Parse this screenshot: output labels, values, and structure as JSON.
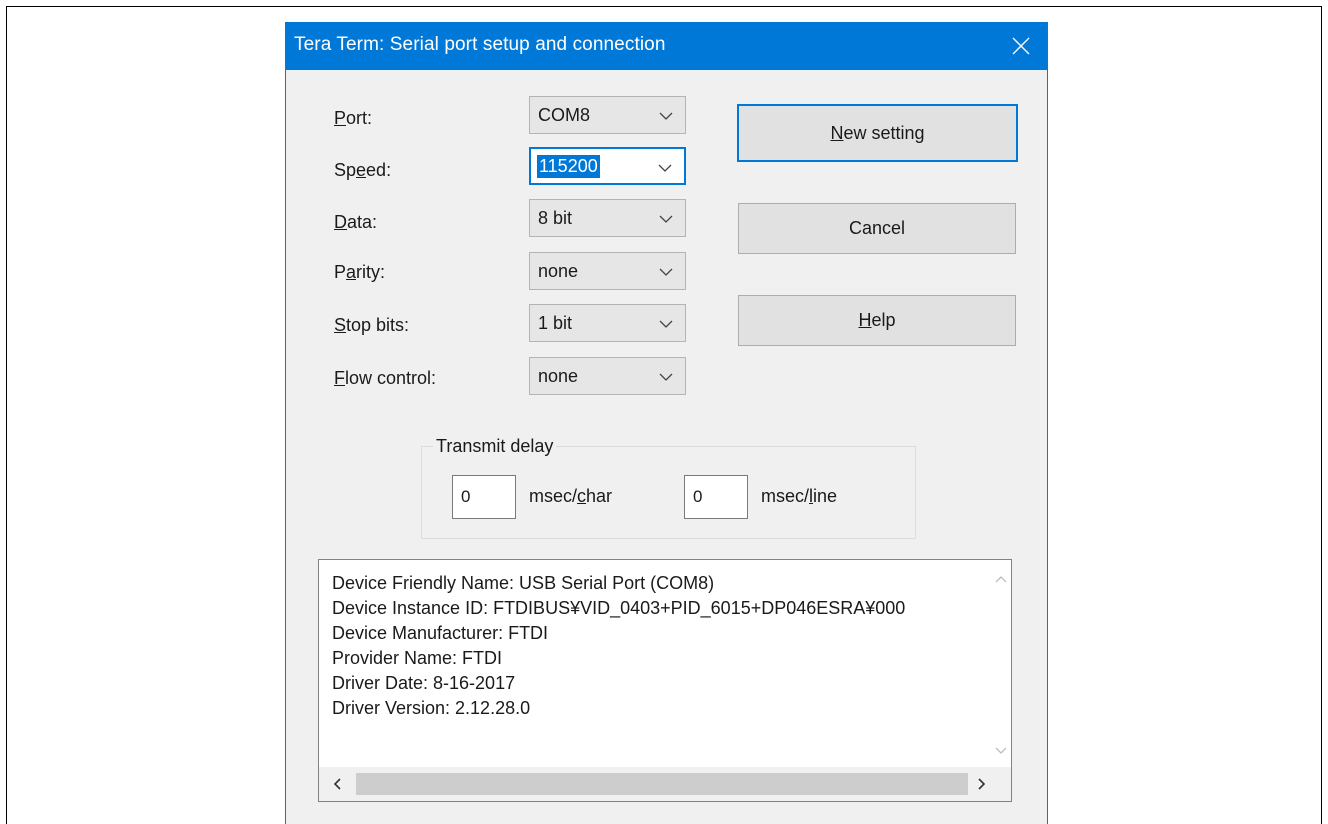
{
  "window": {
    "title": "Tera Term: Serial port setup and connection"
  },
  "fields": [
    {
      "key": "port",
      "label_pre": "",
      "label_u": "P",
      "label_post": "ort:",
      "value": "COM8"
    },
    {
      "key": "speed",
      "label_pre": "Sp",
      "label_u": "e",
      "label_post": "ed:",
      "value": "115200"
    },
    {
      "key": "data",
      "label_pre": "",
      "label_u": "D",
      "label_post": "ata:",
      "value": "8 bit"
    },
    {
      "key": "parity",
      "label_pre": "P",
      "label_u": "a",
      "label_post": "rity:",
      "value": "none"
    },
    {
      "key": "stop",
      "label_pre": "",
      "label_u": "S",
      "label_post": "top bits:",
      "value": "1 bit"
    },
    {
      "key": "flow",
      "label_pre": "",
      "label_u": "F",
      "label_post": "low control:",
      "value": "none"
    }
  ],
  "buttons": {
    "new_setting": {
      "pre": "",
      "u": "N",
      "post": "ew setting"
    },
    "cancel": {
      "label": "Cancel"
    },
    "help": {
      "pre": "",
      "u": "H",
      "post": "elp"
    }
  },
  "transmit_delay": {
    "title": "Transmit delay",
    "char_value": "0",
    "char_label_pre": "msec/",
    "char_label_u": "c",
    "char_label_post": "har",
    "line_value": "0",
    "line_label_pre": "msec/",
    "line_label_u": "l",
    "line_label_post": "ine"
  },
  "device_info": {
    "lines": [
      "Device Friendly Name: USB Serial Port (COM8)",
      "Device Instance ID: FTDIBUS¥VID_0403+PID_6015+DP046ESRA¥000",
      "Device Manufacturer: FTDI",
      "Provider Name: FTDI",
      "Driver Date: 8-16-2017",
      "Driver Version: 2.12.28.0"
    ]
  },
  "colors": {
    "titlebar": "#0078d7",
    "dialog_bg": "#f0f0f0",
    "focus": "#0078d7"
  }
}
